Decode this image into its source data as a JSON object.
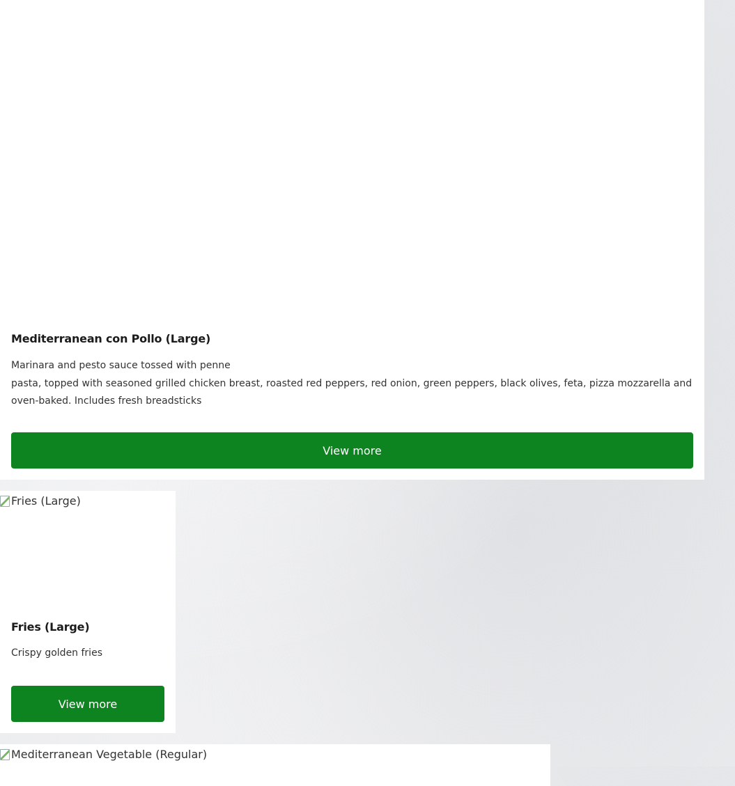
{
  "items": [
    {
      "image_alt": "",
      "title": "Mediterranean con Pollo (Large)",
      "description_line1": "Marinara and pesto sauce tossed with penne",
      "description_rest": "pasta, topped with seasoned grilled chicken breast, roasted red peppers, red onion, green peppers, black olives, feta, pizza mozzarella and oven-baked. Includes fresh breadsticks",
      "button_label": "View more"
    },
    {
      "image_alt": "Fries (Large)",
      "title": "Fries (Large)",
      "description": "Crispy golden fries",
      "button_label": "View more"
    },
    {
      "image_alt": "Mediterranean Vegetable (Regular)"
    }
  ],
  "colors": {
    "button_bg": "#0e8421",
    "button_text": "#ffffff",
    "card_bg": "#ffffff"
  }
}
